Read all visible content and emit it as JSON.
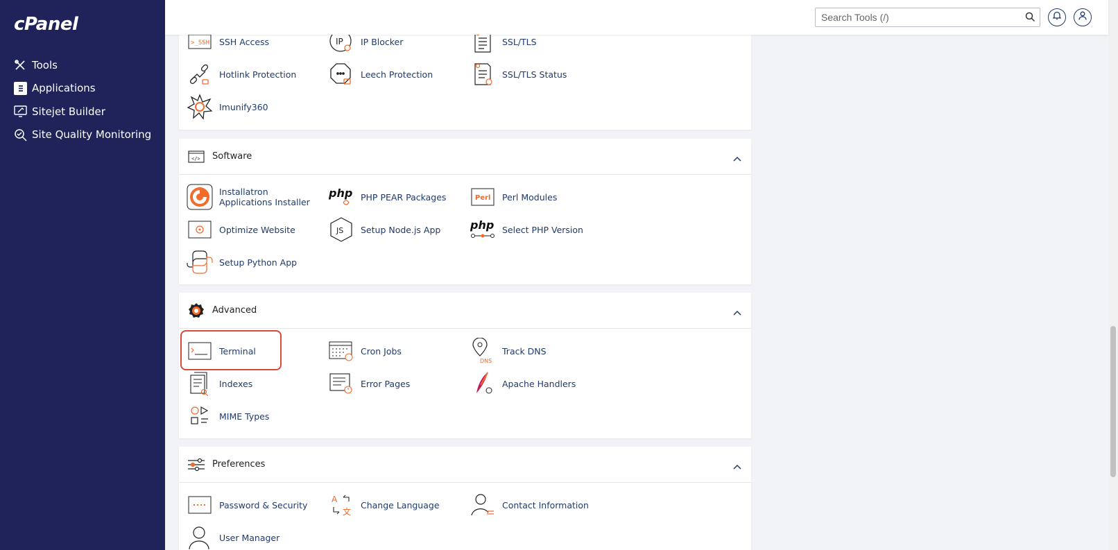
{
  "brand": {
    "logo": "cPanel"
  },
  "sidebar": {
    "items": [
      {
        "label": "Tools",
        "icon": "tools-icon"
      },
      {
        "label": "Applications",
        "icon": "applications-icon"
      },
      {
        "label": "Sitejet Builder",
        "icon": "sitejet-icon"
      },
      {
        "label": "Site Quality Monitoring",
        "icon": "site-quality-icon"
      }
    ]
  },
  "header": {
    "search_placeholder": "Search Tools (/)"
  },
  "security": {
    "items": [
      {
        "label": "SSH Access",
        "icon": "ssh-icon"
      },
      {
        "label": "IP Blocker",
        "icon": "ip-blocker-icon"
      },
      {
        "label": "SSL/TLS",
        "icon": "ssl-tls-icon"
      },
      {
        "label": "Hotlink Protection",
        "icon": "hotlink-icon"
      },
      {
        "label": "Leech Protection",
        "icon": "leech-icon"
      },
      {
        "label": "SSL/TLS Status",
        "icon": "ssl-status-icon"
      },
      {
        "label": "Imunify360",
        "icon": "imunify-icon"
      }
    ]
  },
  "software": {
    "title": "Software",
    "items": [
      {
        "label": "Installatron Applications Installer",
        "icon": "installatron-icon"
      },
      {
        "label": "PHP PEAR Packages",
        "icon": "php-pear-icon"
      },
      {
        "label": "Perl Modules",
        "icon": "perl-icon"
      },
      {
        "label": "Optimize Website",
        "icon": "optimize-icon"
      },
      {
        "label": "Setup Node.js App",
        "icon": "nodejs-icon"
      },
      {
        "label": "Select PHP Version",
        "icon": "php-version-icon"
      },
      {
        "label": "Setup Python App",
        "icon": "python-icon"
      }
    ]
  },
  "advanced": {
    "title": "Advanced",
    "items": [
      {
        "label": "Terminal",
        "icon": "terminal-icon"
      },
      {
        "label": "Cron Jobs",
        "icon": "cron-icon"
      },
      {
        "label": "Track DNS",
        "icon": "track-dns-icon"
      },
      {
        "label": "Indexes",
        "icon": "indexes-icon"
      },
      {
        "label": "Error Pages",
        "icon": "error-pages-icon"
      },
      {
        "label": "Apache Handlers",
        "icon": "apache-icon"
      },
      {
        "label": "MIME Types",
        "icon": "mime-icon"
      }
    ]
  },
  "preferences": {
    "title": "Preferences",
    "items": [
      {
        "label": "Password & Security",
        "icon": "password-icon"
      },
      {
        "label": "Change Language",
        "icon": "language-icon"
      },
      {
        "label": "Contact Information",
        "icon": "contact-icon"
      },
      {
        "label": "User Manager",
        "icon": "user-manager-icon"
      }
    ]
  },
  "icon_text": {
    "ssh": ">_SSH",
    "ip": "IP",
    "php": "php",
    "perl": "Perl",
    "js": "JS",
    "dns": "DNS",
    "lang_a": "A",
    "lang_b": "文"
  },
  "colors": {
    "sidebar_bg": "#1f235a",
    "accent_orange": "#f26b2a",
    "link": "#1f3a6b",
    "highlight": "#d9483b"
  }
}
